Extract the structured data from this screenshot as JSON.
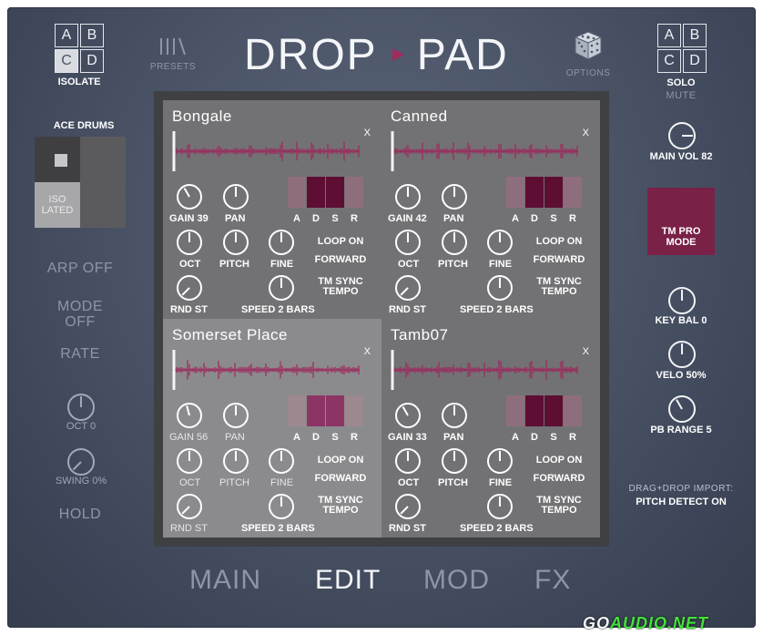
{
  "header": {
    "isolate_grid": [
      {
        "label": "A",
        "on": false
      },
      {
        "label": "B",
        "on": false
      },
      {
        "label": "C",
        "on": true
      },
      {
        "label": "D",
        "on": false
      }
    ],
    "isolate_label": "ISOLATE",
    "presets_label": "PRESETS",
    "logo_left": "DROP",
    "logo_right": "PAD",
    "options_label": "OPTIONS",
    "solo_grid": [
      {
        "label": "A",
        "on": false
      },
      {
        "label": "B",
        "on": false
      },
      {
        "label": "C",
        "on": false
      },
      {
        "label": "D",
        "on": false
      }
    ],
    "solo_label": "SOLO",
    "mute_label": "MUTE"
  },
  "left_panel": {
    "kit_name": "ACE DRUMS",
    "xy_iso_label": "ISO\nLATED",
    "arp": "ARP OFF",
    "mode": "MODE\nOFF",
    "rate": "RATE",
    "oct_label": "OCT 0",
    "swing_label": "SWING 0%",
    "hold": "HOLD"
  },
  "right_panel": {
    "main_vol_label": "MAIN VOL 82",
    "tm_pro_label": "TM PRO\nMODE",
    "key_bal_label": "KEY BAL 0",
    "velo_label": "VELO 50%",
    "pb_range_label": "PB RANGE 5",
    "drag_drop_label": "DRAG+DROP IMPORT:",
    "pitch_detect_label": "PITCH DETECT ON"
  },
  "slots": [
    {
      "name": "Bongale",
      "gain_label": "GAIN 39",
      "pan_label": "PAN",
      "oct_label": "OCT",
      "pitch_label": "PITCH",
      "fine_label": "FINE",
      "rnd_label": "RND ST",
      "speed_label": "SPEED  2 BARS",
      "loop_label": "LOOP ON",
      "dir_label": "FORWARD",
      "sync_label": "TM SYNC\nTEMPO",
      "close": "X",
      "adsr_labels": [
        "A",
        "D",
        "S",
        "R"
      ],
      "light": false
    },
    {
      "name": "Canned",
      "gain_label": "GAIN 42",
      "pan_label": "PAN",
      "oct_label": "OCT",
      "pitch_label": "PITCH",
      "fine_label": "FINE",
      "rnd_label": "RND ST",
      "speed_label": "SPEED  2 BARS",
      "loop_label": "LOOP ON",
      "dir_label": "FORWARD",
      "sync_label": "TM SYNC\nTEMPO",
      "close": "X",
      "adsr_labels": [
        "A",
        "D",
        "S",
        "R"
      ],
      "light": false
    },
    {
      "name": "Somerset Place",
      "gain_label": "GAIN 56",
      "pan_label": "PAN",
      "oct_label": "OCT",
      "pitch_label": "PITCH",
      "fine_label": "FINE",
      "rnd_label": "RND ST",
      "speed_label": "SPEED  2 BARS",
      "loop_label": "LOOP ON",
      "dir_label": "FORWARD",
      "sync_label": "TM SYNC\nTEMPO",
      "close": "X",
      "adsr_labels": [
        "A",
        "D",
        "S",
        "R"
      ],
      "light": true
    },
    {
      "name": "Tamb07",
      "gain_label": "GAIN 33",
      "pan_label": "PAN",
      "oct_label": "OCT",
      "pitch_label": "PITCH",
      "fine_label": "FINE",
      "rnd_label": "RND ST",
      "speed_label": "SPEED  2 BARS",
      "loop_label": "LOOP ON",
      "dir_label": "FORWARD",
      "sync_label": "TM SYNC\nTEMPO",
      "close": "X",
      "adsr_labels": [
        "A",
        "D",
        "S",
        "R"
      ],
      "light": false
    }
  ],
  "tabs": [
    {
      "label": "MAIN",
      "active": false
    },
    {
      "label": "EDIT",
      "active": true
    },
    {
      "label": "MOD",
      "active": false
    },
    {
      "label": "FX",
      "active": false
    }
  ],
  "watermark": {
    "part1": "GO",
    "part2": "AUDIO.NET"
  },
  "colors": {
    "accent": "#a02c5e",
    "accent_dark": "#5e0d33",
    "panel_bg": "#4a5466",
    "text_dim": "#8d96a8"
  }
}
